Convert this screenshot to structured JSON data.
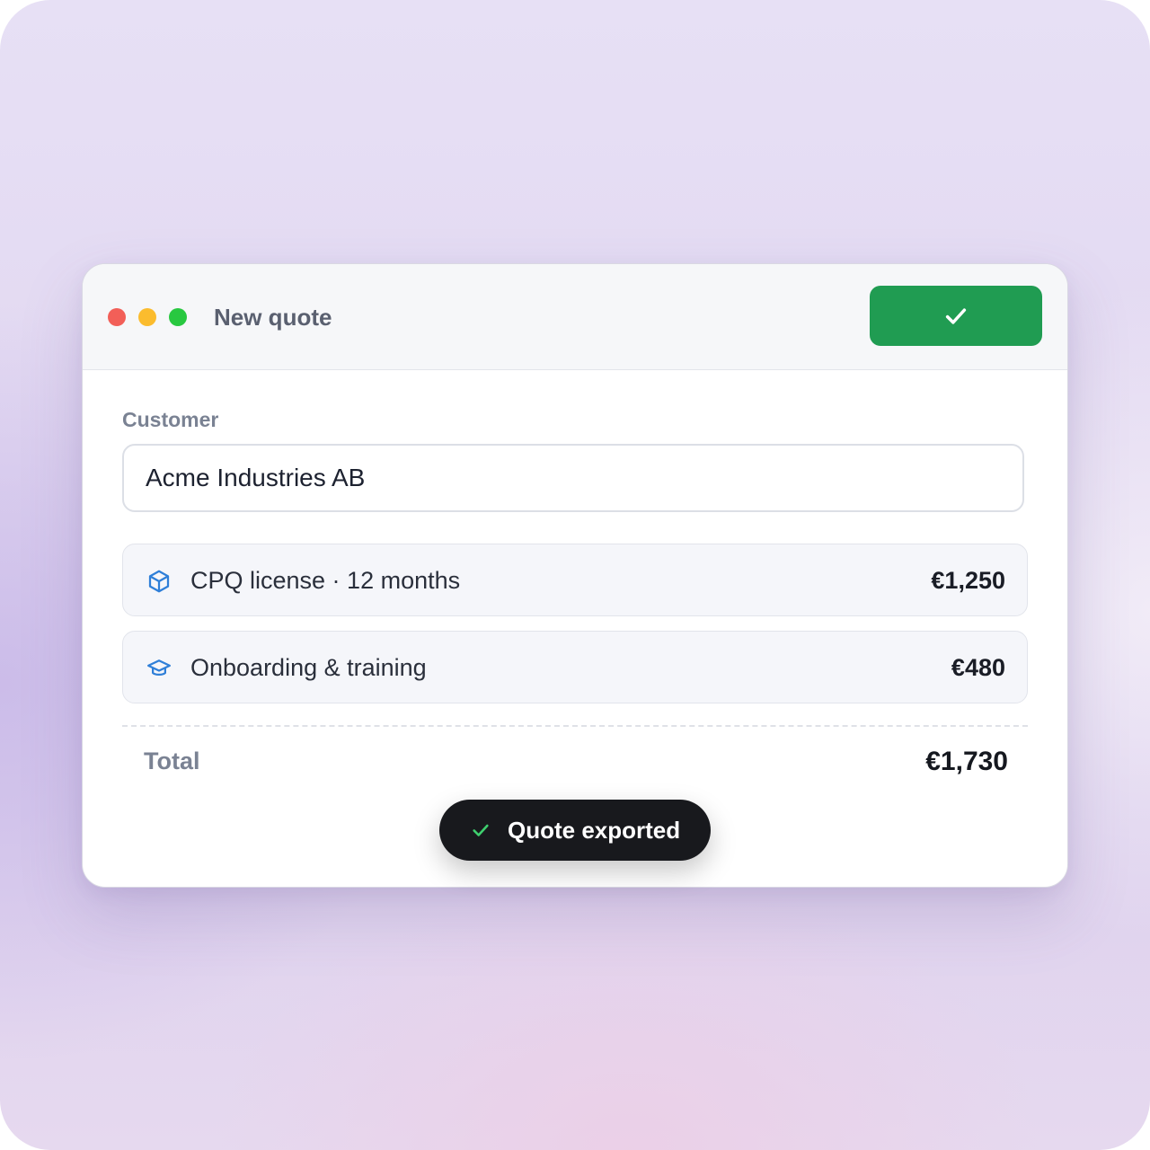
{
  "window": {
    "title": "New quote",
    "confirm_icon": "checkmark-icon",
    "accent_color": "#209c52",
    "traffic_lights": {
      "close_color": "#f25f58",
      "minimize_color": "#fbbc2e",
      "zoom_color": "#28c840"
    }
  },
  "customer": {
    "label": "Customer",
    "value": "Acme Industries AB"
  },
  "line_items": [
    {
      "icon": "box-icon",
      "name": "CPQ license · 12 months",
      "price": "€1,250"
    },
    {
      "icon": "graduation-cap-icon",
      "name": "Onboarding & training",
      "price": "€480"
    }
  ],
  "total": {
    "label": "Total",
    "value": "€1,730"
  },
  "toast": {
    "icon": "checkmark-icon",
    "message": "Quote exported",
    "icon_color": "#3ecf6e"
  }
}
